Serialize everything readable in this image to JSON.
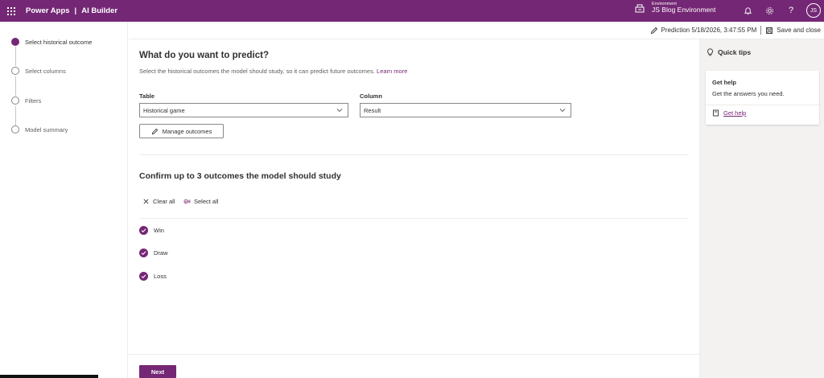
{
  "header": {
    "app_name": "Power Apps",
    "separator": "|",
    "product": "AI Builder",
    "environment_label": "Environment",
    "environment_name": "JS Blog Environment",
    "user_initials": "JS",
    "icons": [
      "waffle-icon",
      "environment-icon",
      "bell-icon",
      "gear-icon",
      "help-icon"
    ]
  },
  "command_bar": {
    "prediction_label": "Prediction 5/18/2026, 3:47:55 PM",
    "save_label": "Save and close"
  },
  "steps": [
    {
      "label": "Select historical outcome",
      "active": true
    },
    {
      "label": "Select columns",
      "active": false
    },
    {
      "label": "Filters",
      "active": false
    },
    {
      "label": "Model summary",
      "active": false
    }
  ],
  "main": {
    "title": "What do you want to predict?",
    "description": "Select the historical outcomes the model should study, so it can predict future outcomes.",
    "learn_more": "Learn more",
    "table_label": "Table",
    "table_value": "Historical game",
    "column_label": "Column",
    "column_value": "Result",
    "manage_label": "Manage outcomes",
    "outcomes_title": "Confirm up to 3 outcomes the model should study",
    "clear_all": "Clear all",
    "select_all": "Select all",
    "outcomes": [
      {
        "label": "Win",
        "checked": true
      },
      {
        "label": "Draw",
        "checked": true
      },
      {
        "label": "Loss",
        "checked": true
      }
    ],
    "next_label": "Next"
  },
  "quick_tips": {
    "title": "Quick tips",
    "card_title": "Get help",
    "card_text": "Get the answers you need.",
    "link_label": "Get help"
  },
  "colors": {
    "brand": "#742774",
    "border": "#8a8886",
    "panel_bg": "#f3f2f1"
  }
}
